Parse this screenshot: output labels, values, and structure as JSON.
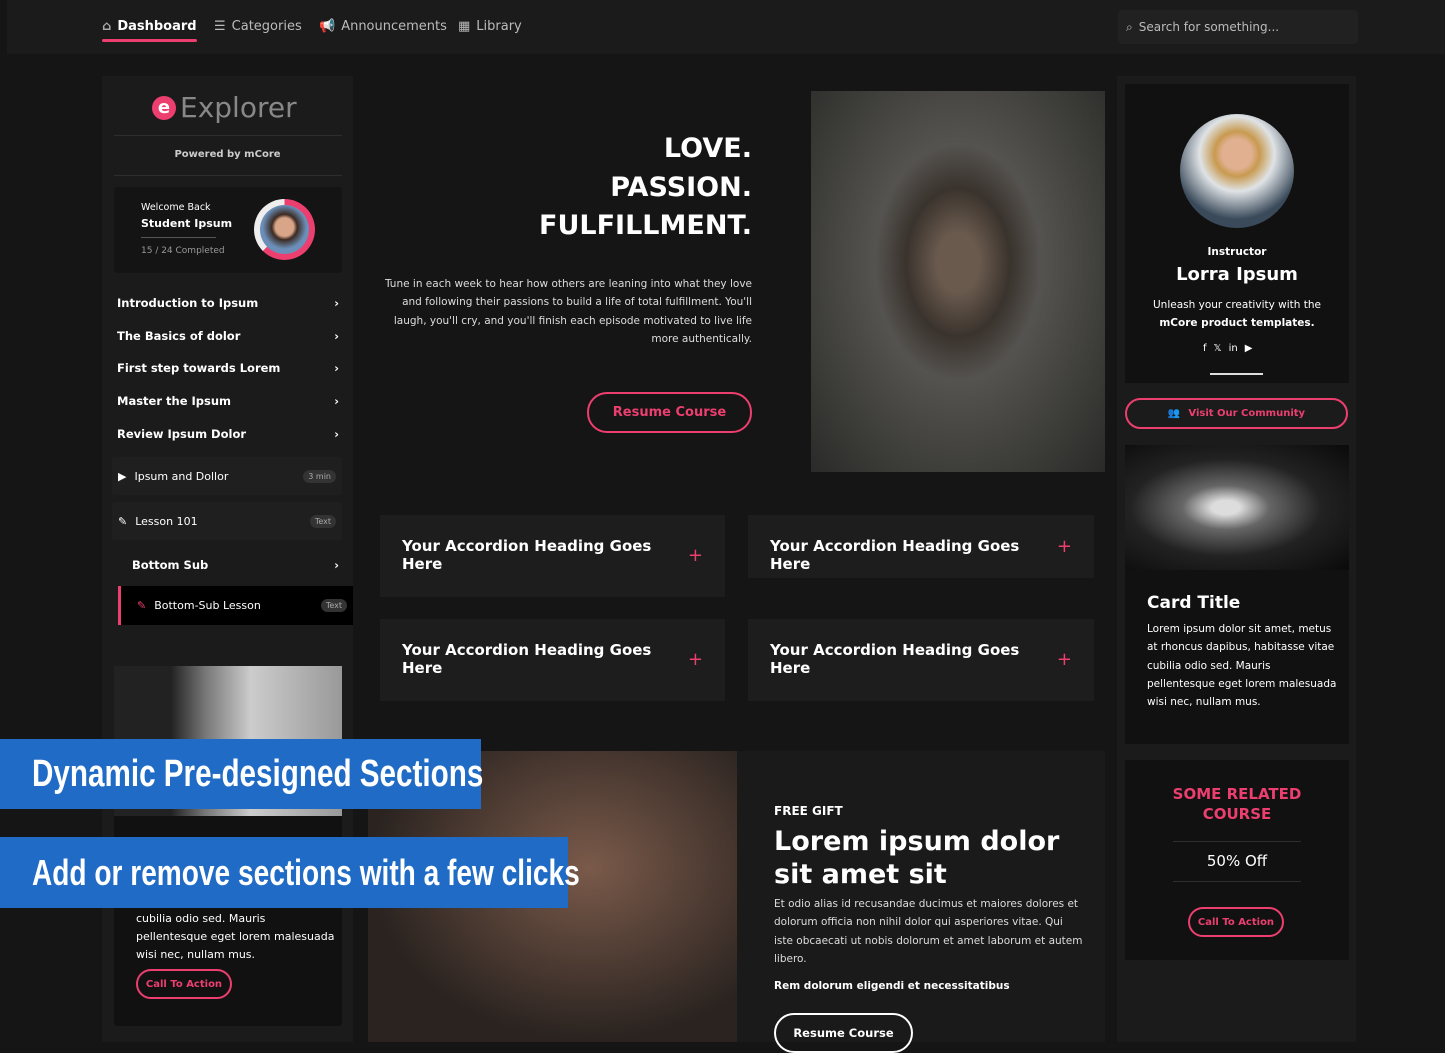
{
  "nav": {
    "items": [
      {
        "label": "Dashboard",
        "icon": "home-icon",
        "active": true
      },
      {
        "label": "Categories",
        "icon": "list-icon"
      },
      {
        "label": "Announcements",
        "icon": "megaphone-icon"
      },
      {
        "label": "Library",
        "icon": "table-icon"
      }
    ],
    "search_placeholder": "Search for something..."
  },
  "sidebar": {
    "logo": "Explorer",
    "powered": "Powered by mCore",
    "welcome": "Welcome Back",
    "student": "Student Ipsum",
    "progress_text": "15 / 24 Completed",
    "progress": {
      "completed": 15,
      "total": 24
    },
    "menu": [
      "Introduction to Ipsum",
      "The Basics of dolor",
      "First step towards Lorem",
      "Master the Ipsum",
      "Review Ipsum Dolor"
    ],
    "lessons": [
      {
        "label": "Ipsum and Dollor",
        "badge": "3 min",
        "icon": "play-icon"
      },
      {
        "label": "Lesson 101",
        "badge": "Text",
        "icon": "pencil-icon"
      }
    ],
    "bottom_sub": "Bottom Sub",
    "bottom_lesson": {
      "label": "Bottom-Sub Lesson",
      "badge": "Text"
    },
    "card_text": [
      "cubilia odio sed. Mauris",
      "pellentesque eget lorem malesuada",
      "wisi nec, nullam mus."
    ],
    "cta": "Call To Action"
  },
  "hero": {
    "title": [
      "LOVE.",
      "PASSION.",
      "FULFILLMENT."
    ],
    "text": [
      "Tune in each week to hear how others are leaning into what they love",
      "and following their passions to build a life of total fulfillment. You'll",
      "laugh, you'll cry, and you'll finish each episode motivated to live life",
      "more authentically."
    ],
    "button": "Resume Course"
  },
  "accordions": [
    [
      "Your Accordion Heading Goes",
      "Here"
    ],
    [
      "Your Accordion Heading Goes Here"
    ],
    [
      "Your Accordion Heading Goes",
      "Here"
    ],
    [
      "Your Accordion Heading Goes",
      "Here"
    ]
  ],
  "gift": {
    "eyebrow": "FREE GIFT",
    "title": [
      "Lorem ipsum dolor",
      "sit amet sit"
    ],
    "text": [
      "Et odio alias id recusandae ducimus et maiores dolores et",
      "dolorum officia non nihil dolor qui asperiores vitae. Qui",
      "iste obcaecati ut nobis dolorum et amet laborum et autem",
      "libero."
    ],
    "bold": "Rem dolorum eligendi et necessitatibus",
    "button": "Resume Course"
  },
  "instructor": {
    "role": "Instructor",
    "name": "Lorra Ipsum",
    "text1": "Unleash your creativity with the",
    "text2": "mCore product templates.",
    "social": [
      "facebook-icon",
      "x-icon",
      "linkedin-icon",
      "youtube-icon"
    ],
    "community": "Visit Our Community"
  },
  "card": {
    "title": "Card Title",
    "text": [
      "Lorem ipsum dolor sit amet, metus",
      "at rhoncus dapibus, habitasse vitae",
      "cubilia odio sed. Mauris",
      "pellentesque eget lorem malesuada",
      "wisi nec, nullam mus."
    ]
  },
  "related": {
    "title": [
      "SOME RELATED",
      "COURSE"
    ],
    "offer": "50% Off",
    "cta": "Call To Action"
  },
  "banners": [
    "Dynamic Pre-designed Sections",
    "Add or remove sections with a few clicks"
  ],
  "colors": {
    "accent": "#ec3f6f",
    "banner": "#1f6bc5"
  }
}
